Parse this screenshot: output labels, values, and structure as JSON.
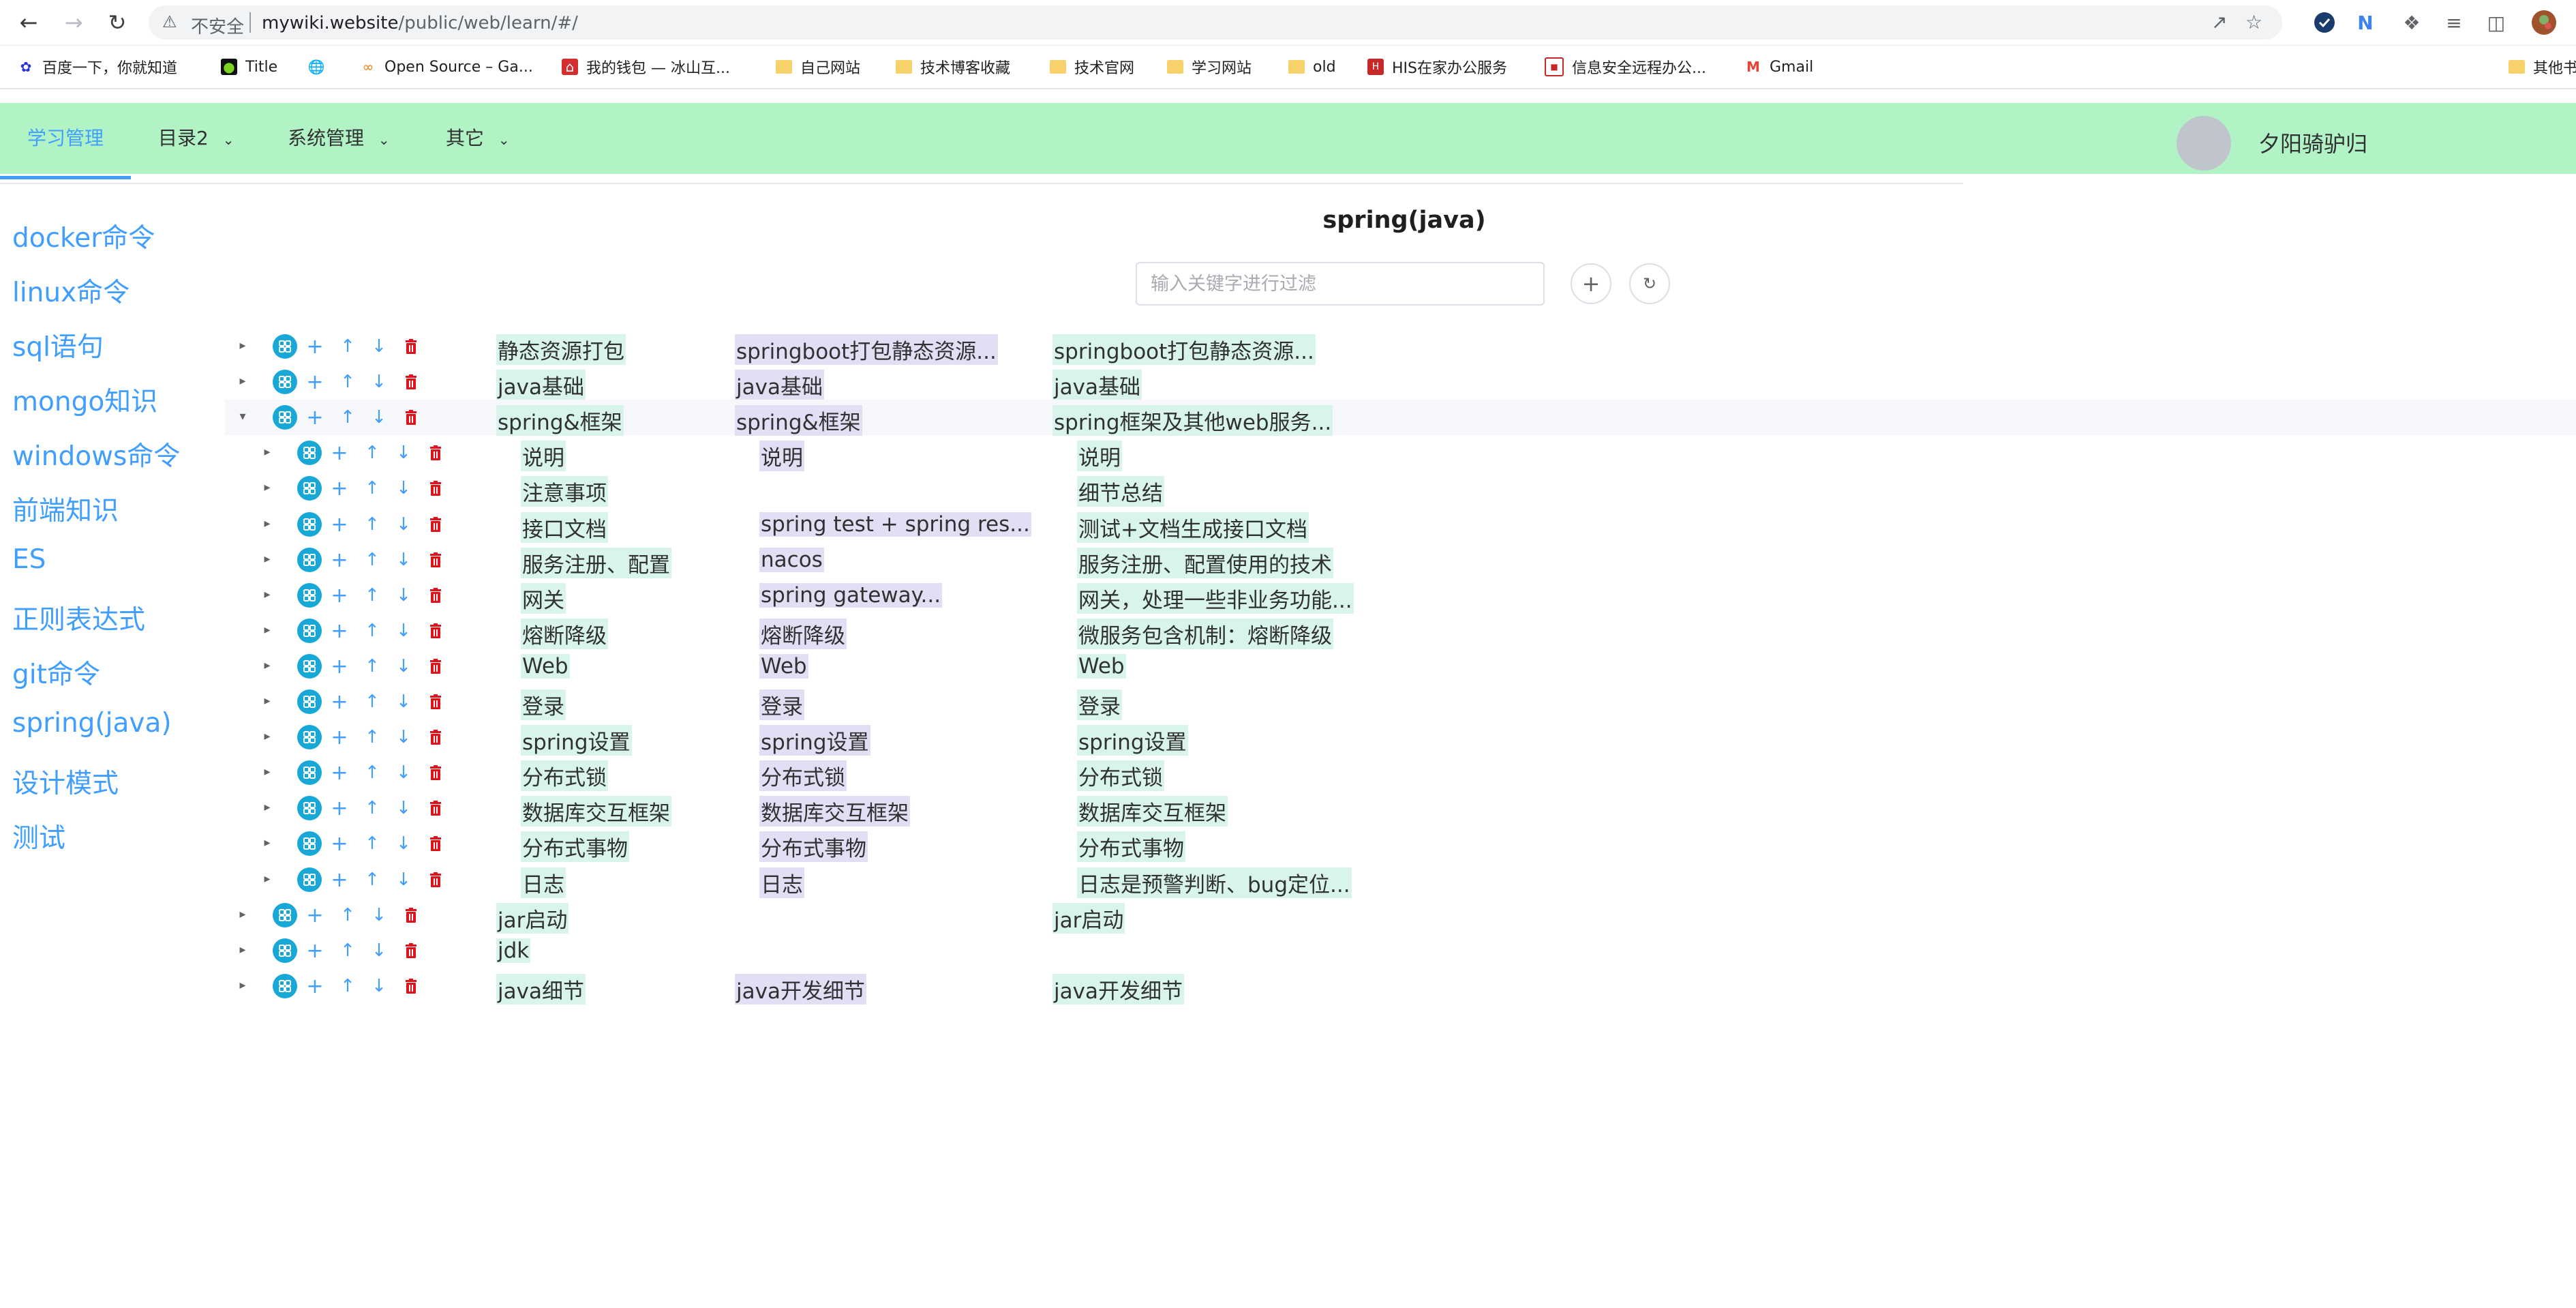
{
  "browser": {
    "insecure_label": "不安全",
    "url_host": "mywiki.website",
    "url_path": "/public/web/learn/#/",
    "bookmarks": [
      {
        "label": "百度一下，你就知道",
        "icon": "baidu-paw-icon"
      },
      {
        "label": "Title",
        "icon": "frog-icon"
      },
      {
        "label": "",
        "icon": "globe-icon"
      },
      {
        "label": "Open Source – Ga...",
        "icon": "open-source-icon"
      },
      {
        "label": "我的钱包 — 冰山互...",
        "icon": "wallet-icon"
      },
      {
        "label": "自己网站",
        "icon": "folder-icon"
      },
      {
        "label": "技术博客收藏",
        "icon": "folder-icon"
      },
      {
        "label": "技术官网",
        "icon": "folder-icon"
      },
      {
        "label": "学习网站",
        "icon": "folder-icon"
      },
      {
        "label": "old",
        "icon": "folder-icon"
      },
      {
        "label": "HIS在家办公服务",
        "icon": "his-icon"
      },
      {
        "label": "信息安全远程办公...",
        "icon": "remote-office-icon"
      },
      {
        "label": "Gmail",
        "icon": "gmail-icon"
      },
      {
        "label": "其他书",
        "icon": "folder-icon"
      }
    ]
  },
  "header": {
    "menu": [
      {
        "label": "学习管理",
        "has_dropdown": false,
        "active": true
      },
      {
        "label": "目录2",
        "has_dropdown": true
      },
      {
        "label": "系统管理",
        "has_dropdown": true
      },
      {
        "label": "其它",
        "has_dropdown": true
      }
    ],
    "username": "夕阳骑驴归"
  },
  "sidebar": {
    "items": [
      "docker命令",
      "linux命令",
      "sql语句",
      "mongo知识",
      "windows命令",
      "前端知识",
      "ES",
      "正则表达式",
      "git命令",
      "spring(java)",
      "设计模式",
      "测试"
    ]
  },
  "main": {
    "title": "spring(java)",
    "filter_placeholder": "输入关键字进行过滤",
    "tree": [
      {
        "level": 0,
        "expanded": false,
        "c1": "静态资源打包",
        "c2": "springboot打包静态资源...",
        "c3": "springboot打包静态资源..."
      },
      {
        "level": 0,
        "expanded": false,
        "c1": "java基础",
        "c2": "java基础",
        "c3": "java基础"
      },
      {
        "level": 0,
        "expanded": true,
        "highlight": true,
        "c1": "spring&框架",
        "c2": "spring&框架",
        "c3": "spring框架及其他web服务..."
      },
      {
        "level": 1,
        "expanded": false,
        "c1": "说明",
        "c2": "说明",
        "c3": "说明"
      },
      {
        "level": 1,
        "expanded": false,
        "c1": "注意事项",
        "c2": "",
        "c3": "细节总结"
      },
      {
        "level": 1,
        "expanded": false,
        "c1": "接口文档",
        "c2": "spring test + spring res...",
        "c3": "测试+文档生成接口文档"
      },
      {
        "level": 1,
        "expanded": false,
        "c1": "服务注册、配置",
        "c2": "nacos",
        "c3": "服务注册、配置使用的技术"
      },
      {
        "level": 1,
        "expanded": false,
        "c1": "网关",
        "c2": "spring gateway...",
        "c3": "网关，处理一些非业务功能..."
      },
      {
        "level": 1,
        "expanded": false,
        "c1": "熔断降级",
        "c2": "熔断降级",
        "c3": "微服务包含机制：熔断降级"
      },
      {
        "level": 1,
        "expanded": false,
        "c1": "Web",
        "c2": "Web",
        "c3": "Web"
      },
      {
        "level": 1,
        "expanded": false,
        "c1": "登录",
        "c2": "登录",
        "c3": "登录"
      },
      {
        "level": 1,
        "expanded": false,
        "c1": "spring设置",
        "c2": "spring设置",
        "c3": "spring设置"
      },
      {
        "level": 1,
        "expanded": false,
        "c1": "分布式锁",
        "c2": "分布式锁",
        "c3": "分布式锁"
      },
      {
        "level": 1,
        "expanded": false,
        "c1": "数据库交互框架",
        "c2": "数据库交互框架",
        "c3": "数据库交互框架"
      },
      {
        "level": 1,
        "expanded": false,
        "c1": "分布式事物",
        "c2": "分布式事物",
        "c3": "分布式事物"
      },
      {
        "level": 1,
        "expanded": false,
        "c1": "日志",
        "c2": "日志",
        "c3": "日志是预警判断、bug定位..."
      },
      {
        "level": 0,
        "expanded": false,
        "c1": "jar启动",
        "c2": "",
        "c3": "jar启动"
      },
      {
        "level": 0,
        "expanded": false,
        "c1": "jdk",
        "c2": "",
        "c3": ""
      },
      {
        "level": 0,
        "expanded": false,
        "c1": "java细节",
        "c2": "java开发细节",
        "c3": "java开发细节"
      }
    ]
  }
}
